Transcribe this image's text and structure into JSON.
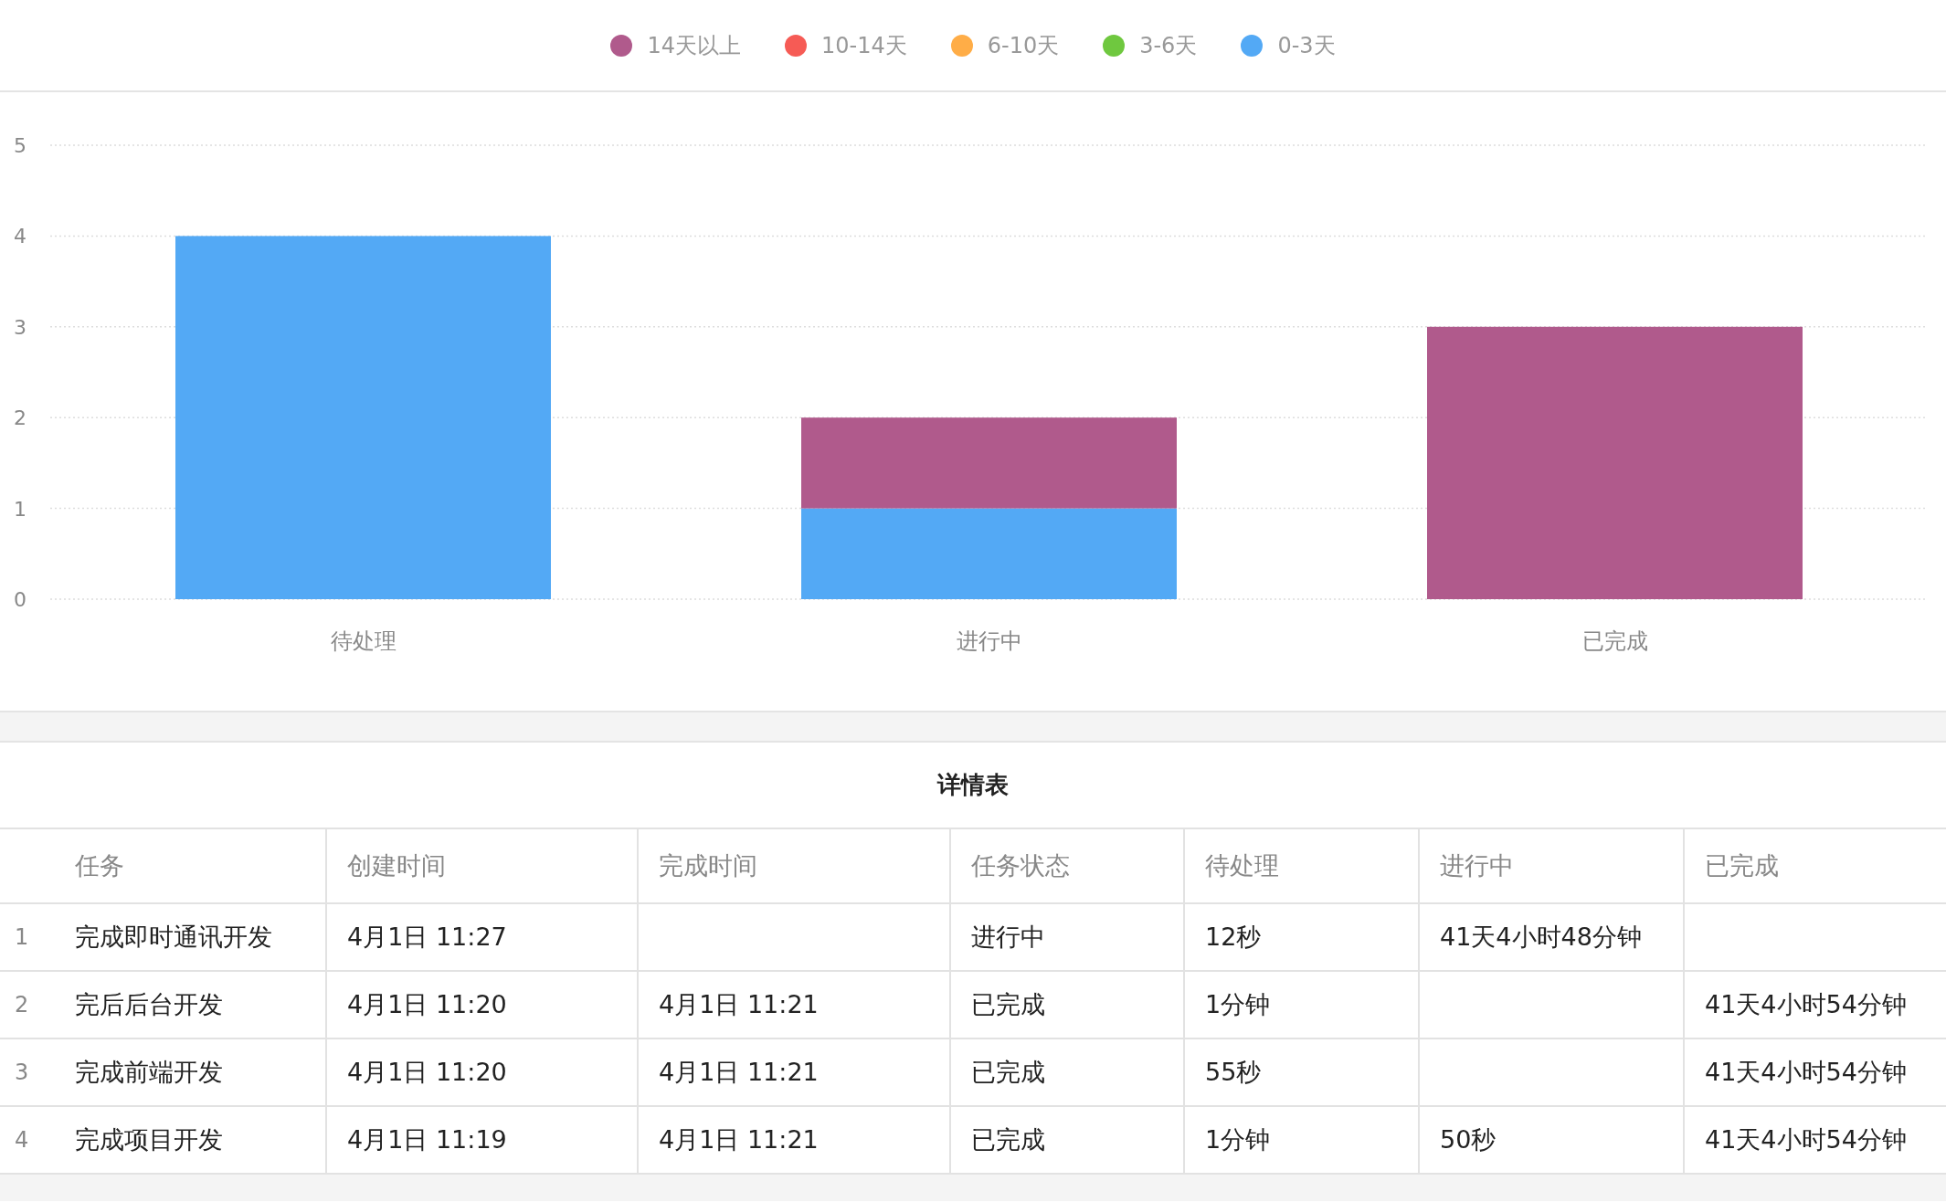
{
  "chart": {
    "chart_data": {
      "type": "bar",
      "stacked": true,
      "orientation": "vertical",
      "categories": [
        "待处理",
        "进行中",
        "已完成"
      ],
      "ylim": [
        0,
        5
      ],
      "grid": true,
      "yticks": [
        0,
        1,
        2,
        3,
        4,
        5
      ],
      "series": [
        {
          "name": "14天以上",
          "color": "#b05a8c",
          "values": [
            0,
            1,
            3
          ]
        },
        {
          "name": "10-14天",
          "color": "#f65b55",
          "values": [
            0,
            0,
            0
          ]
        },
        {
          "name": "6-10天",
          "color": "#ffad47",
          "values": [
            0,
            0,
            0
          ]
        },
        {
          "name": "3-6天",
          "color": "#6fc83f",
          "values": [
            0,
            0,
            0
          ]
        },
        {
          "name": "0-3天",
          "color": "#53a9f5",
          "values": [
            4,
            1,
            0
          ]
        }
      ]
    }
  },
  "table": {
    "title": "详情表",
    "columns": [
      "任务",
      "创建时间",
      "完成时间",
      "任务状态",
      "待处理",
      "进行中",
      "已完成"
    ],
    "rows": [
      {
        "number": "1",
        "cells": [
          "完成即时通讯开发",
          "4月1日 11:27",
          null,
          "进行中",
          "12秒",
          "41天4小时48分钟",
          null
        ]
      },
      {
        "number": "2",
        "cells": [
          "完后后台开发",
          "4月1日 11:20",
          "4月1日 11:21",
          "已完成",
          "1分钟",
          null,
          "41天4小时54分钟"
        ]
      },
      {
        "number": "3",
        "cells": [
          "完成前端开发",
          "4月1日 11:20",
          "4月1日 11:21",
          "已完成",
          "55秒",
          null,
          "41天4小时54分钟"
        ]
      },
      {
        "number": "4",
        "cells": [
          "完成项目开发",
          "4月1日 11:19",
          "4月1日 11:21",
          "已完成",
          "1分钟",
          "50秒",
          "41天4小时54分钟"
        ]
      }
    ]
  }
}
